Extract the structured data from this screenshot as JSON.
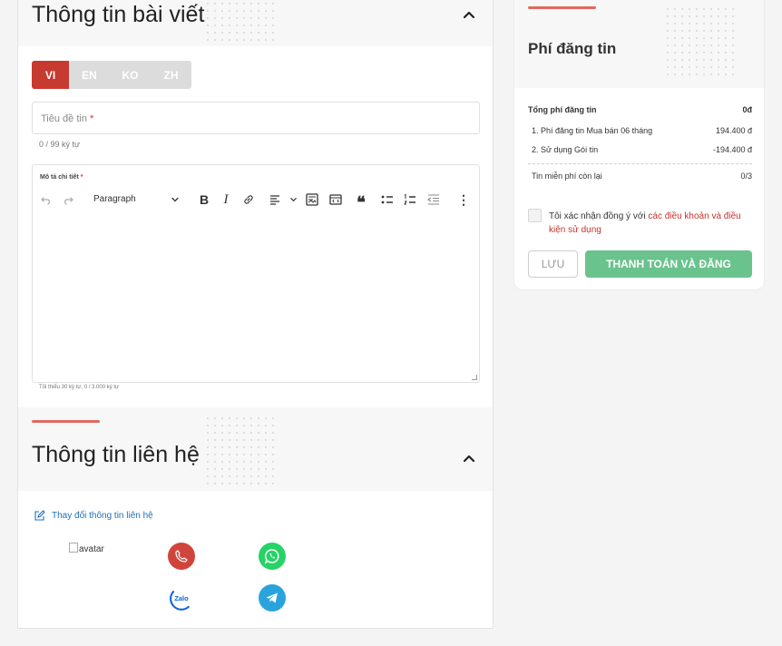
{
  "post_info": {
    "title": "Thông tin bài viết",
    "languages": [
      "VI",
      "EN",
      "KO",
      "ZH"
    ],
    "title_field": {
      "placeholder": "Tiêu đề tin",
      "required_mark": "*",
      "counter": "0 / 99 ký tự"
    },
    "description": {
      "label": "Mô tả chi tiết",
      "required_mark": "*",
      "toolbar": {
        "paragraph_label": "Paragraph"
      },
      "counter": "Tối thiểu 30 ký tự, 0 / 3.000 ký tự"
    }
  },
  "contact_info": {
    "title": "Thông tin liên hệ",
    "edit_link": "Thay đổi thông tin liên hệ",
    "avatar_alt": "avatar",
    "zalo_label": "Zalo"
  },
  "fees": {
    "title": "Phí đăng tin",
    "total_label": "Tổng phí đăng tin",
    "total_value": "0đ",
    "items": [
      {
        "label": "1. Phí đăng tin Mua bán 06 tháng",
        "value": "194.400 đ"
      },
      {
        "label": "2. Sử dụng Gói tin",
        "value": "-194.400 đ"
      }
    ],
    "free_label": "Tin miễn phí còn lại",
    "free_value": "0/3",
    "agree_prefix": "Tôi xác nhận đồng ý với ",
    "agree_link": "các điều khoản và điều kiện sử dụng",
    "save_button": "LƯU",
    "pay_button": "THANH TOÁN VÀ ĐĂNG"
  },
  "colors": {
    "accent": "#c63a2f",
    "pay": "#6ac38c",
    "link": "#1e6fb8",
    "phone": "#d0453b",
    "whatsapp": "#25d366",
    "telegram": "#2aa3dd"
  }
}
